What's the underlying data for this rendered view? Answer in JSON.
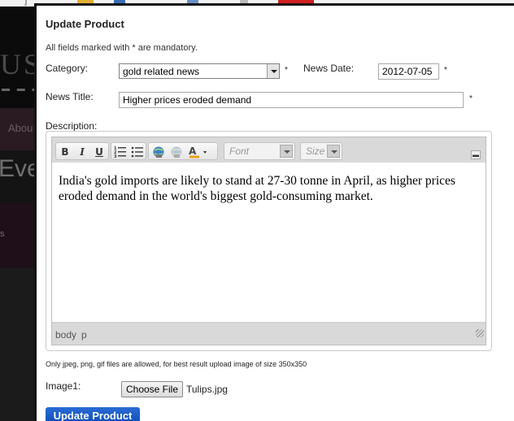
{
  "background": {
    "top_fragment": "]",
    "logo_fragment": "USI",
    "nav_fragment": "Abou",
    "heading_fragment": "Eve",
    "side_fragment": "s"
  },
  "modal": {
    "title": "Update Product",
    "mandatory_note": "All fields marked with * are mandatory."
  },
  "form": {
    "category_label": "Category:",
    "category_value": "gold related news",
    "news_date_label": "News Date:",
    "news_date_value": "2012-07-05",
    "news_title_label": "News Title:",
    "news_title_value": "Higher prices eroded demand",
    "description_label": "Description:",
    "required_mark": "*",
    "upload_note": "Only jpeg, png, gif files are allowed, for best result upload image of size 350x350",
    "image_label": "Image1:",
    "choose_file_label": "Choose File",
    "file_name": "Tulips.jpg",
    "submit_label": "Update Product"
  },
  "editor": {
    "toolbar": {
      "bold": "B",
      "italic": "I",
      "underline": "U",
      "font_placeholder": "Font",
      "size_placeholder": "Size",
      "collapse_symbol": "▬"
    },
    "content": "India's gold imports are likely to stand at 27-30 tonne in April, as higher prices eroded demand in the world's biggest gold-consuming market.",
    "path": [
      "body",
      "p"
    ]
  },
  "icons": [
    "ordered-list-icon",
    "unordered-list-icon",
    "link-icon",
    "unlink-icon",
    "text-color-icon",
    "resize-grip-icon"
  ],
  "colors": {
    "submit_button": "#0b4ab8",
    "overlay": "#1b1b1b",
    "modal_bg": "#ffffff"
  }
}
